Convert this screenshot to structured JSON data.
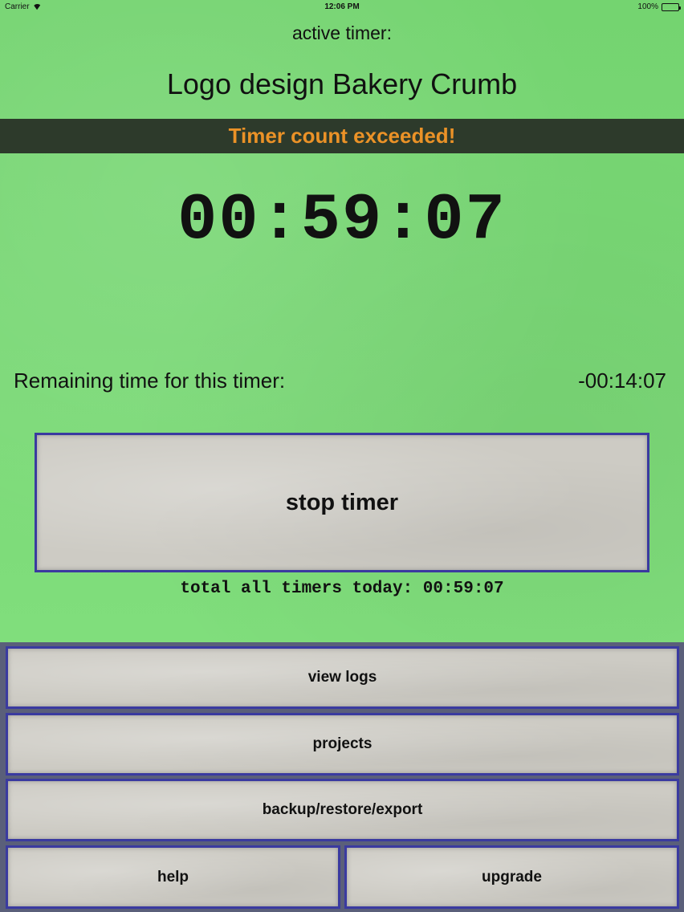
{
  "status_bar": {
    "carrier": "Carrier",
    "time": "12:06 PM",
    "battery": "100%"
  },
  "active_timer": {
    "label": "active timer:",
    "name": "Logo design Bakery Crumb"
  },
  "alert": {
    "text": "Timer count exceeded!",
    "color": "#eb9227"
  },
  "timer": {
    "elapsed": "00:59:07",
    "remaining_label": "Remaining time for this timer:",
    "remaining_value": "-00:14:07"
  },
  "actions": {
    "stop_label": "stop timer"
  },
  "totals": {
    "today": "total all timers today: 00:59:07"
  },
  "nav": {
    "view_logs": "view logs",
    "projects": "projects",
    "backup": "backup/restore/export",
    "help": "help",
    "upgrade": "upgrade"
  },
  "colors": {
    "background_green": "#78d874",
    "button_border": "#3a3aa0",
    "button_paper": "#cdcbc4",
    "alert_bar": "#2d3a2b"
  }
}
